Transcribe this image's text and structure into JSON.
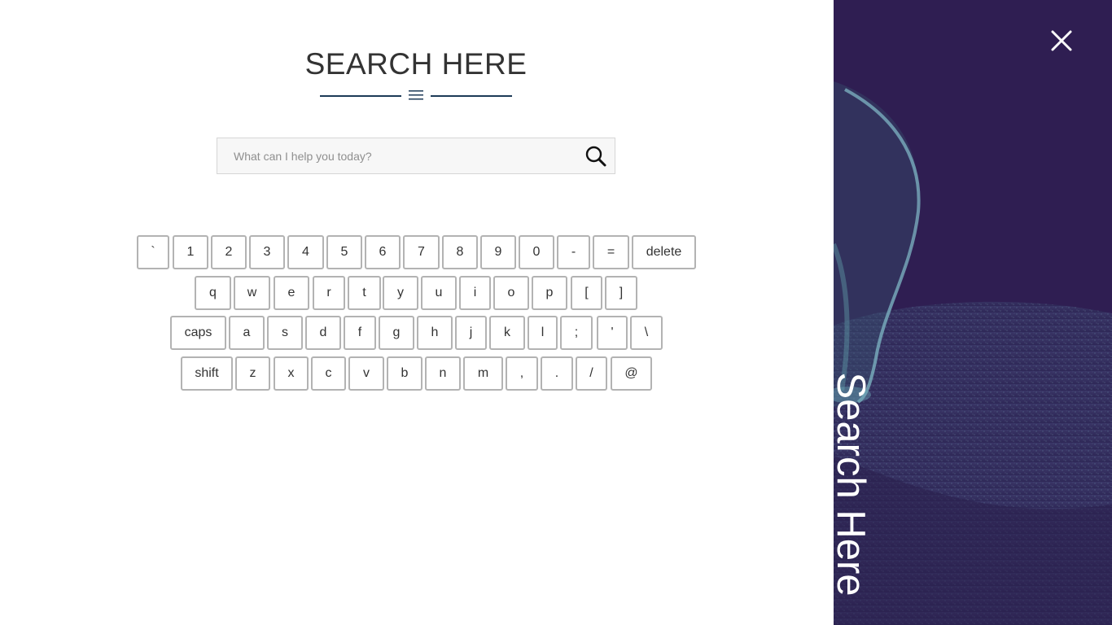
{
  "overlay": {
    "title": "SEARCH HERE",
    "search": {
      "placeholder": "What can I help you today?",
      "value": ""
    },
    "side_panel_text": "Search Here"
  },
  "keyboard": {
    "rows": [
      [
        "`",
        "1",
        "2",
        "3",
        "4",
        "5",
        "6",
        "7",
        "8",
        "9",
        "0",
        "-",
        "=",
        "delete"
      ],
      [
        "q",
        "w",
        "e",
        "r",
        "t",
        "y",
        "u",
        "i",
        "o",
        "p",
        "[",
        "]"
      ],
      [
        "caps",
        "a",
        "s",
        "d",
        "f",
        "g",
        "h",
        "j",
        "k",
        "l",
        ";",
        "'",
        "\\"
      ],
      [
        "shift",
        "z",
        "x",
        "c",
        "v",
        "b",
        "n",
        "m",
        ",",
        ".",
        "/",
        "@"
      ]
    ]
  },
  "icons": {
    "close": "close-icon",
    "search": "search-icon",
    "menu": "menu-icon"
  },
  "colors": {
    "side_panel_bg": "#2f1e52",
    "divider": "#1d3a57",
    "key_border": "#b3b3b3"
  }
}
